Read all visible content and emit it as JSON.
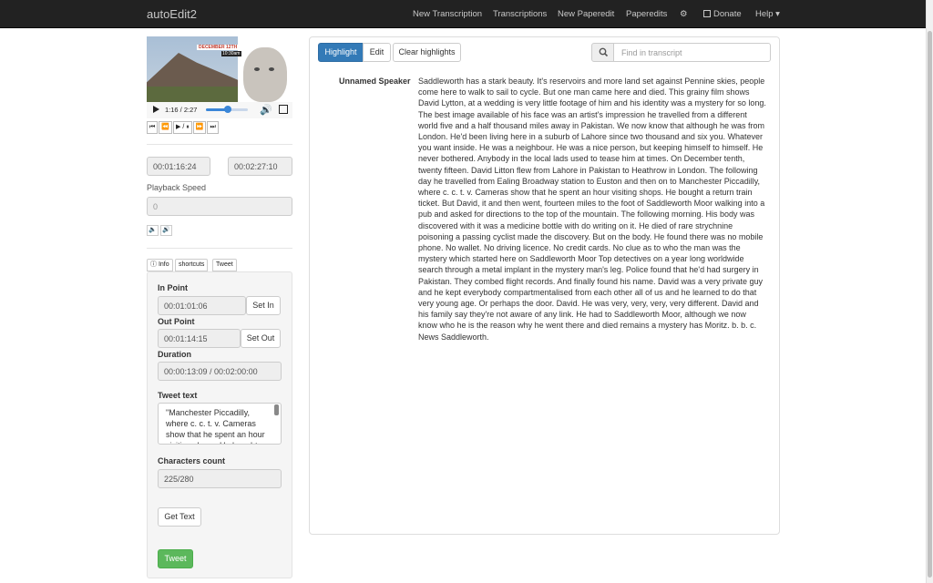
{
  "navbar": {
    "brand": "autoEdit2",
    "links": [
      "New Transcription",
      "Transcriptions",
      "New Paperedit",
      "Paperedits",
      "⚙",
      "Donate",
      "Help ▾"
    ]
  },
  "video": {
    "banner_date": "DECEMBER 12TH",
    "banner_time": "10:30am",
    "time_display": "1:16 / 2:27",
    "progress": 0.52
  },
  "transport": [
    "⏮",
    "⏪",
    "▶ / ⏸",
    "⏩",
    "⏭"
  ],
  "times": {
    "start": "00:01:16:24",
    "end": "00:02:27:10"
  },
  "playback_speed": {
    "label": "Playback Speed",
    "value": "0"
  },
  "speed_buttons": [
    "🔈",
    "🔊"
  ],
  "tabs": [
    "ⓘ Info",
    "shortcuts",
    "Tweet"
  ],
  "tweet_panel": {
    "in_point_label": "In Point",
    "in_point": "00:01:01:06",
    "set_in": "Set In",
    "out_point_label": "Out Point",
    "out_point": "00:01:14:15",
    "set_out": "Set Out",
    "duration_label": "Duration",
    "duration": "00:00:13:09 / 00:02:00:00",
    "tweet_text_label": "Tweet text",
    "tweet_text": "\"Manchester Piccadilly, where c. c. t. v. Cameras show that he spent an hour visiting shops. He bought a",
    "chars_label": "Characters count",
    "chars": "225/280",
    "get_text": "Get Text",
    "tweet": "Tweet"
  },
  "toolbar": {
    "highlight": "Highlight",
    "edit": "Edit",
    "clear": "Clear highlights",
    "search_placeholder": "Find in transcript"
  },
  "transcript": {
    "speaker": "Unnamed Speaker",
    "text": "Saddleworth has a stark beauty. It's reservoirs and more land set against Pennine skies, people come here to walk to sail to cycle. But one man came here and died. This grainy film shows David Lytton, at a wedding is very little footage of him and his identity was a mystery for so long. The best image available of his face was an artist's impression he travelled from a different world five and a half thousand miles away in Pakistan. We now know that although he was from London. He'd been living here in a suburb of Lahore since two thousand and six you. Whatever you want inside. He was a neighbour. He was a nice person, but keeping himself to himself. He never bothered. Anybody in the local lads used to tease him at times. On December tenth, twenty fifteen. David Litton flew from Lahore in Pakistan to Heathrow in London. The following day he travelled from Ealing Broadway station to Euston and then on to Manchester Piccadilly, where c. c. t. v. Cameras show that he spent an hour visiting shops. He bought a return train ticket. But David, it and then went, fourteen miles to the foot of Saddleworth Moor walking into a pub and asked for directions to the top of the mountain. The following morning. His body was discovered with it was a medicine bottle with do writing on it. He died of rare strychnine poisoning a passing cyclist made the discovery. But on the body. He found there was no mobile phone. No wallet. No driving licence. No credit cards. No clue as to who the man was the mystery which started here on Saddleworth Moor Top detectives on a year long worldwide search through a metal implant in the mystery man's leg. Police found that he'd had surgery in Pakistan. They combed flight records. And finally found his name. David was a very private guy and he kept everybody compartmentalised from each other all of us and he learned to do that very young age. Or perhaps the door. David. He was very, very, very, very different. David and his family say they're not aware of any link. He had to Saddleworth Moor, although we now know who he is the reason why he went there and died remains a mystery has Moritz. b. b. c. News Saddleworth."
  }
}
